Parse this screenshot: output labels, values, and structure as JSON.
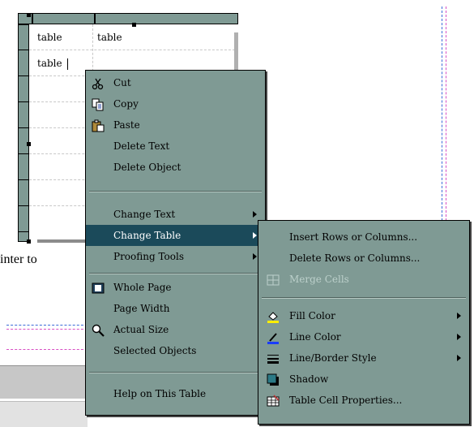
{
  "document": {
    "cells": [
      "table",
      "table",
      "table"
    ],
    "background_text": "inter to"
  },
  "context_menu": {
    "items": [
      {
        "label": "Cut",
        "icon": "scissors-icon",
        "submenu": false,
        "state": "normal"
      },
      {
        "label": "Copy",
        "icon": "copy-icon",
        "submenu": false,
        "state": "normal"
      },
      {
        "label": "Paste",
        "icon": "paste-icon",
        "submenu": false,
        "state": "normal"
      },
      {
        "label": "Delete Text",
        "icon": "",
        "submenu": false,
        "state": "normal"
      },
      {
        "label": "Delete Object",
        "icon": "",
        "submenu": false,
        "state": "normal"
      },
      {
        "label": "Change Text",
        "icon": "",
        "submenu": true,
        "state": "normal"
      },
      {
        "label": "Change Table",
        "icon": "",
        "submenu": true,
        "state": "highlighted"
      },
      {
        "label": "Proofing Tools",
        "icon": "",
        "submenu": true,
        "state": "normal"
      },
      {
        "label": "Whole Page",
        "icon": "whole-page-icon",
        "submenu": false,
        "state": "normal"
      },
      {
        "label": "Page Width",
        "icon": "",
        "submenu": false,
        "state": "normal"
      },
      {
        "label": "Actual Size",
        "icon": "magnifier-icon",
        "submenu": false,
        "state": "normal"
      },
      {
        "label": "Selected Objects",
        "icon": "",
        "submenu": false,
        "state": "normal"
      },
      {
        "label": "Help on This Table",
        "icon": "",
        "submenu": false,
        "state": "normal"
      }
    ]
  },
  "submenu": {
    "items": [
      {
        "label": "Insert Rows or Columns...",
        "icon": "",
        "submenu": false,
        "state": "normal"
      },
      {
        "label": "Delete Rows or Columns...",
        "icon": "",
        "submenu": false,
        "state": "normal"
      },
      {
        "label": "Merge Cells",
        "icon": "merge-cells-icon",
        "submenu": false,
        "state": "disabled"
      },
      {
        "label": "Fill Color",
        "icon": "fill-color-icon",
        "submenu": true,
        "state": "normal"
      },
      {
        "label": "Line Color",
        "icon": "line-color-icon",
        "submenu": true,
        "state": "normal"
      },
      {
        "label": "Line/Border Style",
        "icon": "border-style-icon",
        "submenu": true,
        "state": "normal"
      },
      {
        "label": "Shadow",
        "icon": "shadow-icon",
        "submenu": false,
        "state": "normal"
      },
      {
        "label": "Table Cell Properties...",
        "icon": "cell-properties-icon",
        "submenu": false,
        "state": "normal"
      }
    ]
  },
  "colors": {
    "menu_bg": "#7f9a94",
    "highlight_bg": "#1b4a5a",
    "guide_blue": "#3b6bd8",
    "guide_pink": "#d84fc4"
  }
}
